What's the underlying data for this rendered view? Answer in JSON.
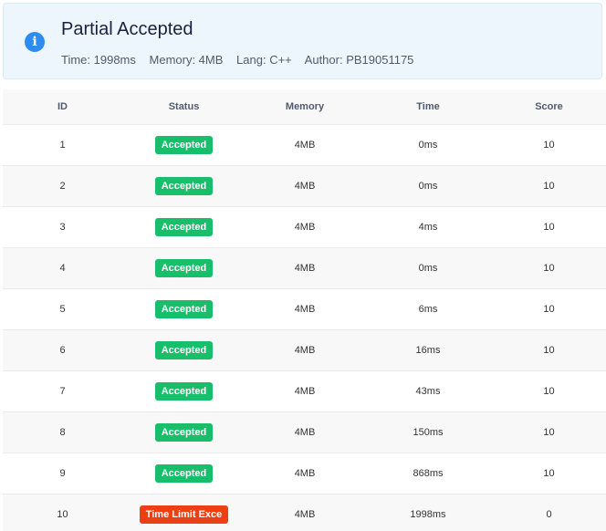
{
  "summary": {
    "title": "Partial Accepted",
    "icon": "info-icon",
    "icon_glyph": "i",
    "time": "Time: 1998ms",
    "memory": "Memory: 4MB",
    "lang": "Lang: C++",
    "author": "Author: PB19051175"
  },
  "table": {
    "headers": [
      "ID",
      "Status",
      "Memory",
      "Time",
      "Score"
    ],
    "rows": [
      {
        "id": "1",
        "status": "Accepted",
        "status_type": "ok",
        "memory": "4MB",
        "time": "0ms",
        "score": "10"
      },
      {
        "id": "2",
        "status": "Accepted",
        "status_type": "ok",
        "memory": "4MB",
        "time": "0ms",
        "score": "10"
      },
      {
        "id": "3",
        "status": "Accepted",
        "status_type": "ok",
        "memory": "4MB",
        "time": "4ms",
        "score": "10"
      },
      {
        "id": "4",
        "status": "Accepted",
        "status_type": "ok",
        "memory": "4MB",
        "time": "0ms",
        "score": "10"
      },
      {
        "id": "5",
        "status": "Accepted",
        "status_type": "ok",
        "memory": "4MB",
        "time": "6ms",
        "score": "10"
      },
      {
        "id": "6",
        "status": "Accepted",
        "status_type": "ok",
        "memory": "4MB",
        "time": "16ms",
        "score": "10"
      },
      {
        "id": "7",
        "status": "Accepted",
        "status_type": "ok",
        "memory": "4MB",
        "time": "43ms",
        "score": "10"
      },
      {
        "id": "8",
        "status": "Accepted",
        "status_type": "ok",
        "memory": "4MB",
        "time": "150ms",
        "score": "10"
      },
      {
        "id": "9",
        "status": "Accepted",
        "status_type": "ok",
        "memory": "4MB",
        "time": "868ms",
        "score": "10"
      },
      {
        "id": "10",
        "status": "Time Limit Exce",
        "status_type": "bad",
        "memory": "4MB",
        "time": "1998ms",
        "score": "0"
      }
    ]
  },
  "colors": {
    "accepted": "#19be6b",
    "time_limit": "#ed3f14",
    "info": "#2d8cf0"
  }
}
